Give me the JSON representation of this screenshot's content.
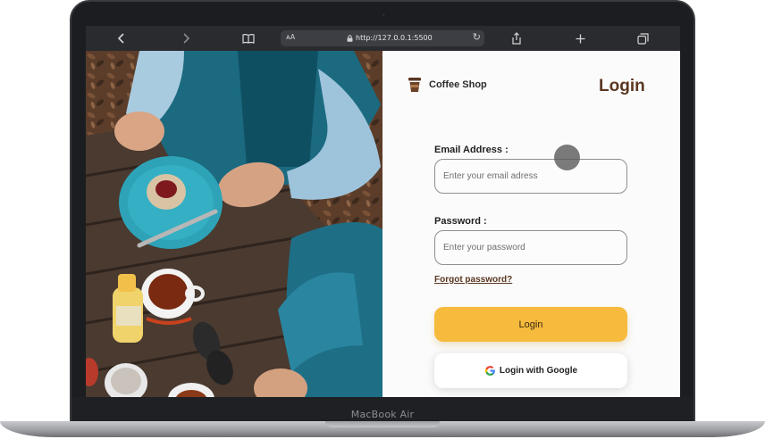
{
  "device": {
    "label": "MacBook Air"
  },
  "browser": {
    "text_size_label": "ᴀA",
    "url": "http://127.0.0.1:5500",
    "icons": [
      "back-icon",
      "forward-icon",
      "reader-icon",
      "lock-icon",
      "reload-icon",
      "share-icon",
      "new-tab-icon",
      "tabs-icon"
    ]
  },
  "brand": {
    "name": "Coffee Shop",
    "icon": "coffee-cup-icon"
  },
  "page": {
    "title": "Login"
  },
  "form": {
    "email_label": "Email Address :",
    "email_placeholder": "Enter your email adress",
    "email_value": "",
    "password_label": "Password :",
    "password_placeholder": "Enter your password",
    "password_value": "",
    "forgot_label": "Forgot password?",
    "login_label": "Login",
    "google_label": "Login with Google"
  },
  "colors": {
    "accent": "#f6ba3c",
    "brand_brown": "#5a3721",
    "toolbar": "#2a2b2f"
  }
}
